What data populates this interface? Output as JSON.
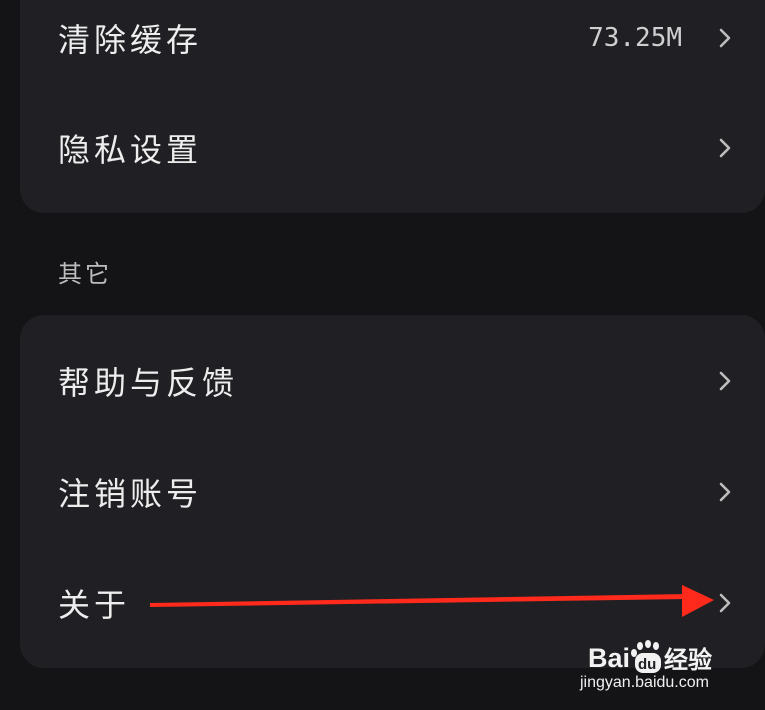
{
  "settings": {
    "group1": [
      {
        "label": "清除缓存",
        "value": "73.25M",
        "icon": "chevron-right-icon"
      },
      {
        "label": "隐私设置",
        "value": "",
        "icon": "chevron-right-icon"
      }
    ],
    "section_other_title": "其它",
    "group2": [
      {
        "label": "帮助与反馈",
        "icon": "chevron-right-icon"
      },
      {
        "label": "注销账号",
        "icon": "chevron-right-icon"
      },
      {
        "label": "关于",
        "icon": "chevron-right-icon"
      }
    ]
  },
  "annotation": {
    "type": "red-arrow",
    "color": "#ff2a1c",
    "points_to": "关于"
  },
  "watermark": {
    "logo_text": "Baidu经验",
    "url": "jingyan.baidu.com"
  },
  "colors": {
    "background": "#141416",
    "card": "#202024",
    "text": "#ededed",
    "chevron": "#bdbdbd"
  }
}
